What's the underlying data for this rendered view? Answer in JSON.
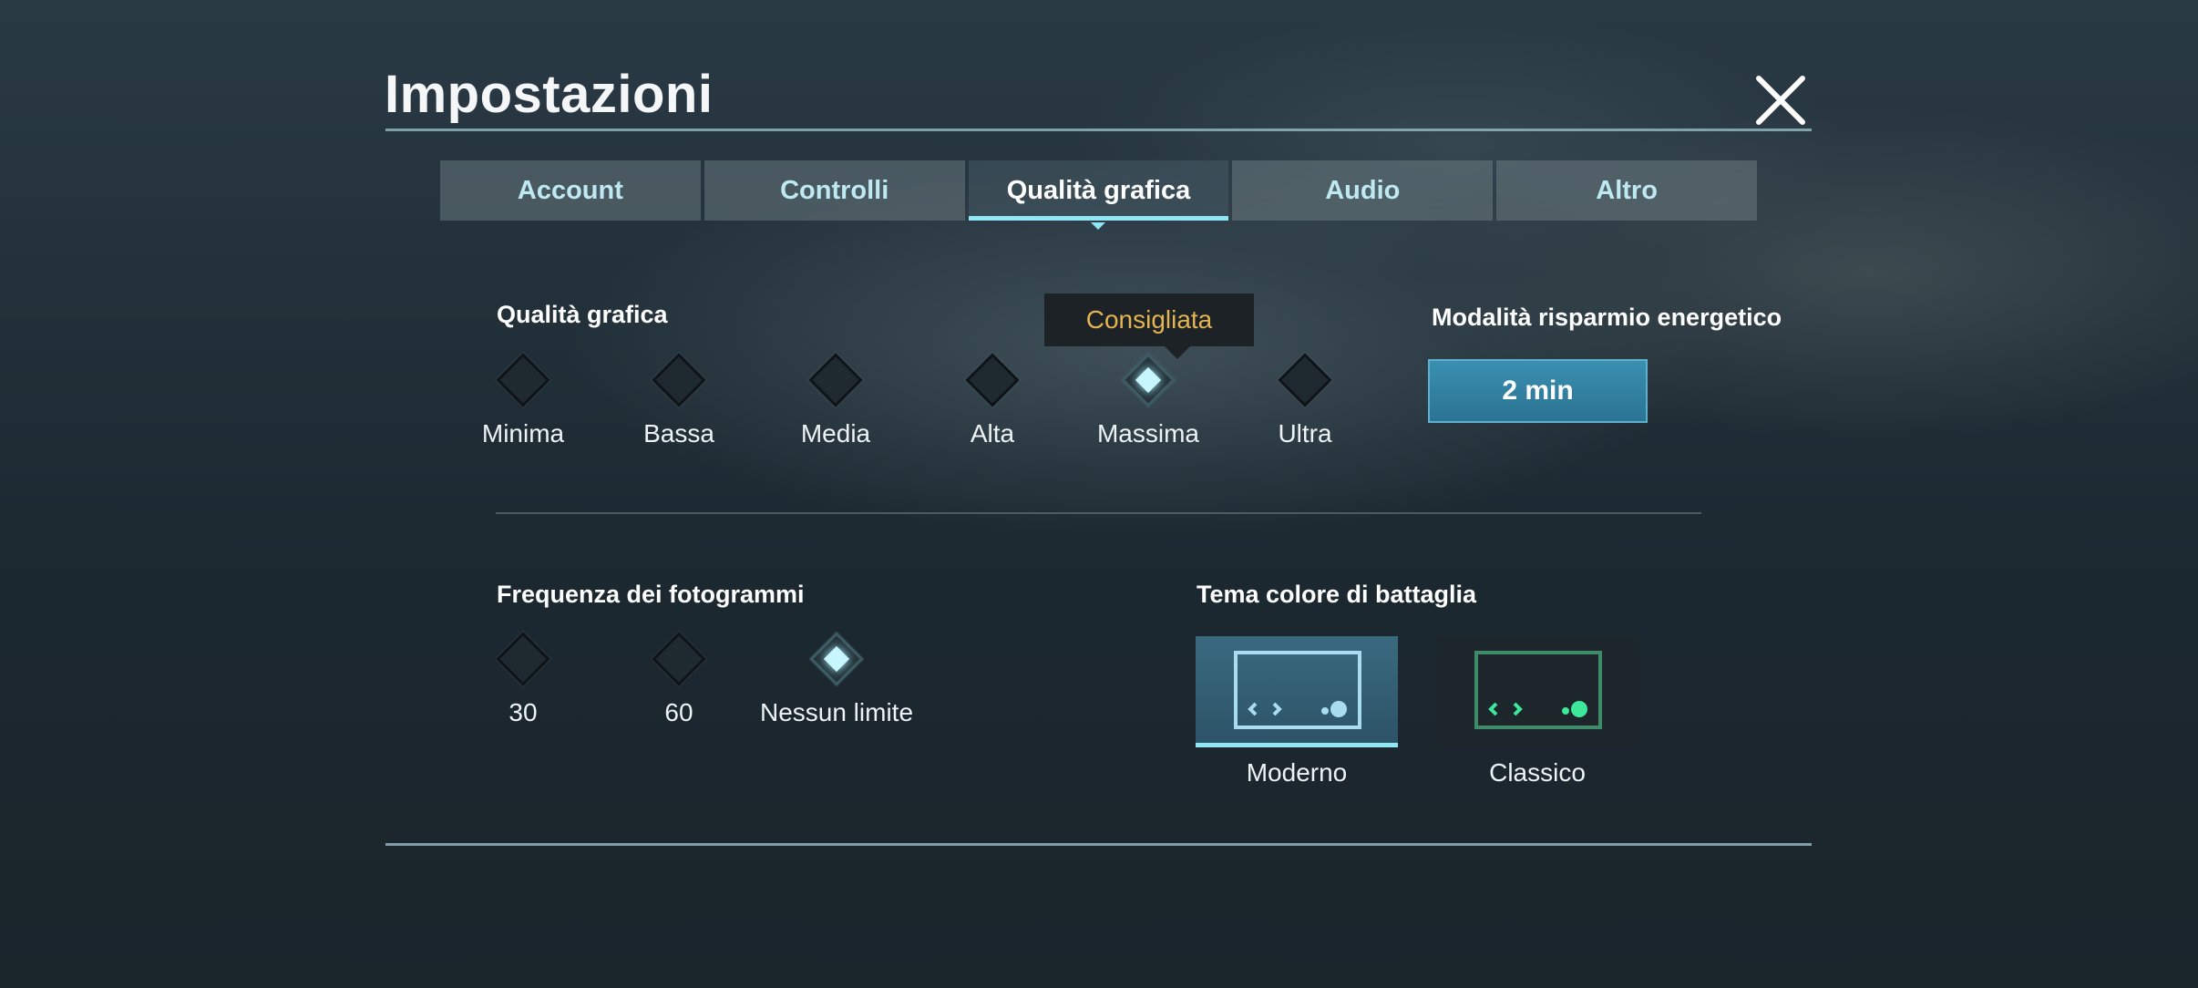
{
  "header": {
    "title": "Impostazioni"
  },
  "tabs": [
    {
      "label": "Account",
      "active": false
    },
    {
      "label": "Controlli",
      "active": false
    },
    {
      "label": "Qualità grafica",
      "active": true
    },
    {
      "label": "Audio",
      "active": false
    },
    {
      "label": "Altro",
      "active": false
    }
  ],
  "graphics_quality": {
    "label": "Qualità grafica",
    "recommended_tooltip": "Consigliata",
    "options": [
      "Minima",
      "Bassa",
      "Media",
      "Alta",
      "Massima",
      "Ultra"
    ],
    "selected": "Massima"
  },
  "energy_saving": {
    "label": "Modalità risparmio energetico",
    "value": "2 min"
  },
  "frame_rate": {
    "label": "Frequenza dei fotogrammi",
    "options": [
      "30",
      "60",
      "Nessun limite"
    ],
    "selected": "Nessun limite"
  },
  "battle_theme": {
    "label": "Tema colore di battaglia",
    "options": [
      "Moderno",
      "Classico"
    ],
    "selected": "Moderno",
    "colors": {
      "modern": "#a9dcee",
      "classic": "#3ee89a"
    }
  },
  "colors": {
    "accent": "#8fe6f5",
    "tooltip_text": "#e3b450",
    "button": "#2f84a6"
  }
}
